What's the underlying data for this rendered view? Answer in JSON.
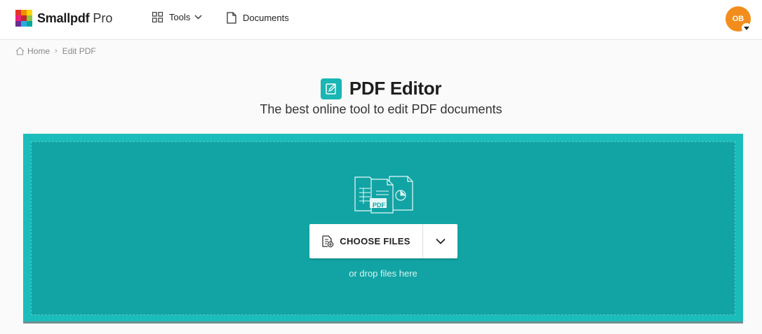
{
  "brand": {
    "name": "Smallpdf",
    "tier": "Pro",
    "logo_colors": [
      "#e6332a",
      "#f29100",
      "#ffd500",
      "#8cc63f",
      "#00a99d",
      "#29abe2",
      "#662d91",
      "#ed1e79",
      "#c1272d"
    ]
  },
  "nav": {
    "tools_label": "Tools",
    "documents_label": "Documents"
  },
  "user": {
    "initials": "OB",
    "avatar_color": "#f28d1c"
  },
  "breadcrumb": {
    "home": "Home",
    "separator": "›",
    "current": "Edit PDF"
  },
  "tool": {
    "title": "PDF Editor",
    "subtitle": "The best online tool to edit PDF documents",
    "icon": "edit-document-icon",
    "accent": "#19b6b4"
  },
  "dropzone": {
    "choose_files_label": "CHOOSE FILES",
    "hint": "or drop files here",
    "badge": "PDF",
    "outer_color": "#1bbdbb",
    "inner_color": "#12a4a4"
  }
}
